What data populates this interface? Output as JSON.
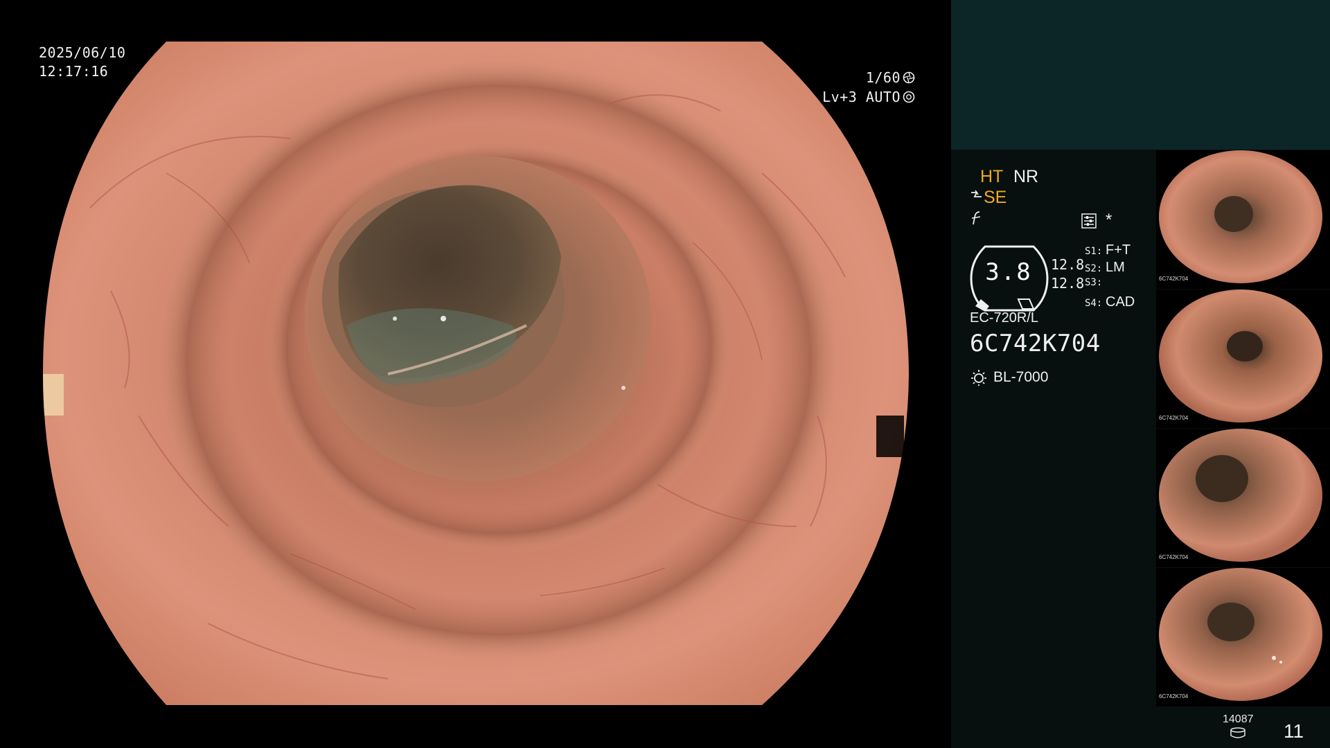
{
  "overlay": {
    "date": "2025/06/10",
    "time": "12:17:16",
    "shutter": "1/60",
    "level_iris": "Lv+3 AUTO"
  },
  "panel": {
    "mode_ht": "HT",
    "mode_nr": "NR",
    "mode_se": "SE",
    "star": "*",
    "gauge_value": "3.8",
    "gauge_right_1": "12.8",
    "gauge_right_2": "12.8",
    "slots": [
      {
        "key": "S1:",
        "value": "F+T"
      },
      {
        "key": "S2:",
        "value": "LM"
      },
      {
        "key": "S3:",
        "value": ""
      },
      {
        "key": "S4:",
        "value": "CAD"
      }
    ],
    "scope_model": "EC-720R/L",
    "scope_serial": "6C742K704",
    "light_source": "BL-7000",
    "storage_count": "14087",
    "image_count": "11"
  },
  "thumbnails": [
    {
      "label": "6C742K704"
    },
    {
      "label": "6C742K704"
    },
    {
      "label": "6C742K704"
    },
    {
      "label": "6C742K704"
    }
  ],
  "icons": [
    "shutter-icon",
    "iris-icon",
    "structure-enhance-icon",
    "f-mode-icon",
    "settings-icon",
    "lamp-icon",
    "storage-icon"
  ],
  "colors": {
    "panel_bg": "#07100f",
    "panel_top": "#0c2628",
    "mode_active": "#f5a623",
    "mucosa": "#d4876a",
    "lumen": "#3d2e24"
  }
}
